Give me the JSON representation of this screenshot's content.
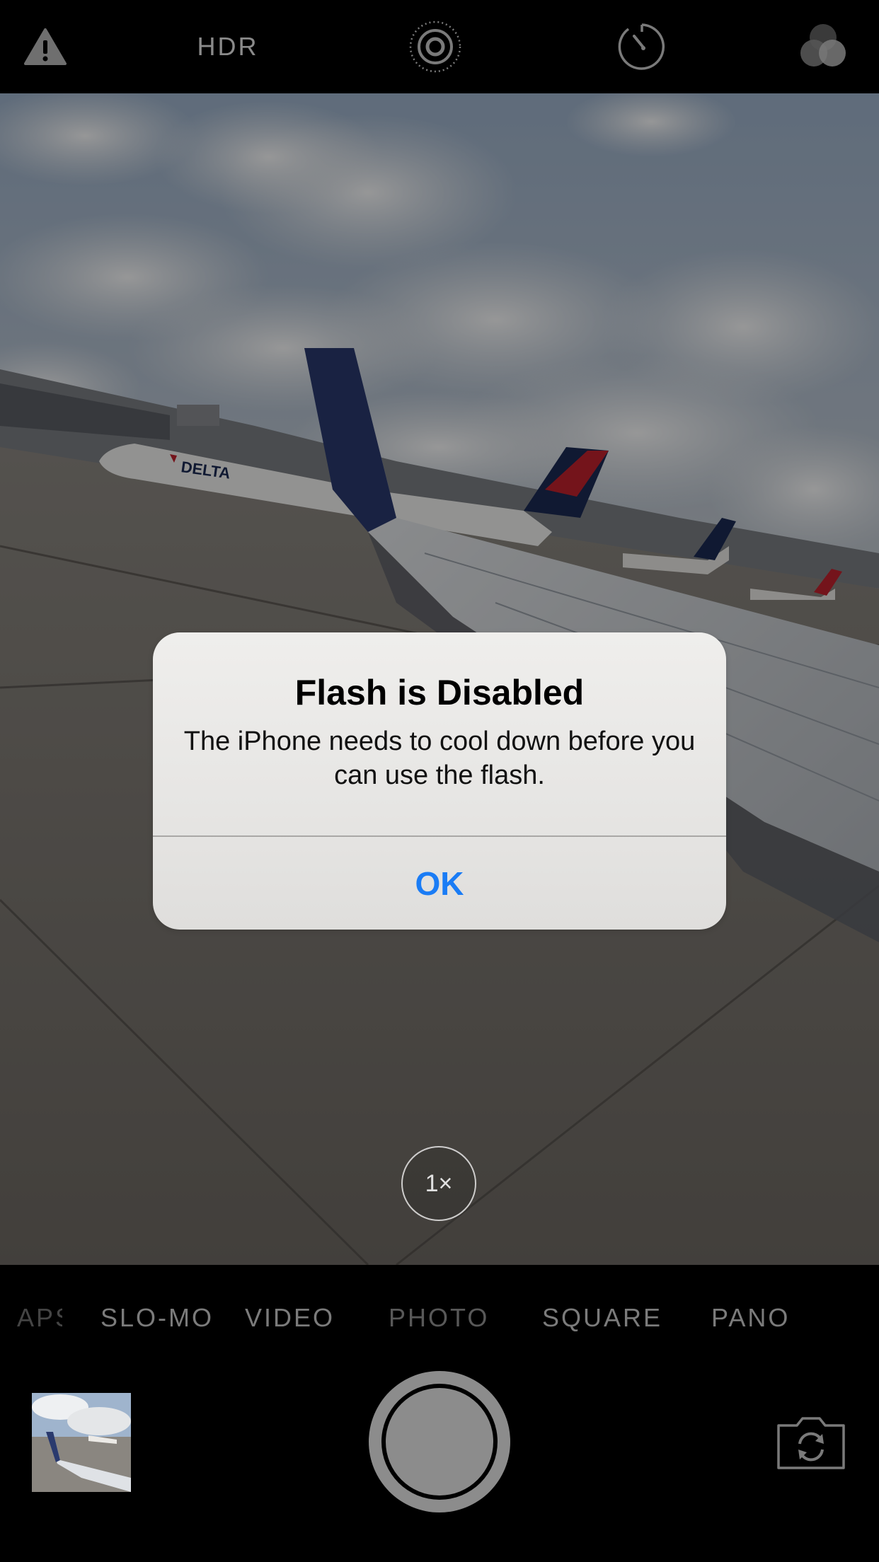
{
  "top_bar": {
    "flash_warning_icon": "warning-triangle-icon",
    "hdr_label": "HDR",
    "live_photo_icon": "live-photo-icon",
    "timer_icon": "timer-icon",
    "filters_icon": "filters-icon"
  },
  "viewfinder": {
    "zoom_label": "1×"
  },
  "alert": {
    "title": "Flash is Disabled",
    "message": "The iPhone needs to cool down before you can use the flash.",
    "ok_label": "OK",
    "ok_color": "#1a7cf5"
  },
  "modes": {
    "items": [
      "APSE",
      "SLO-MO",
      "VIDEO",
      "PHOTO",
      "SQUARE",
      "PANO"
    ],
    "selected": "PHOTO"
  },
  "bottom": {
    "thumbnail_icon": "last-photo-thumbnail",
    "shutter_icon": "shutter-button",
    "switch_camera_icon": "switch-camera-icon"
  }
}
